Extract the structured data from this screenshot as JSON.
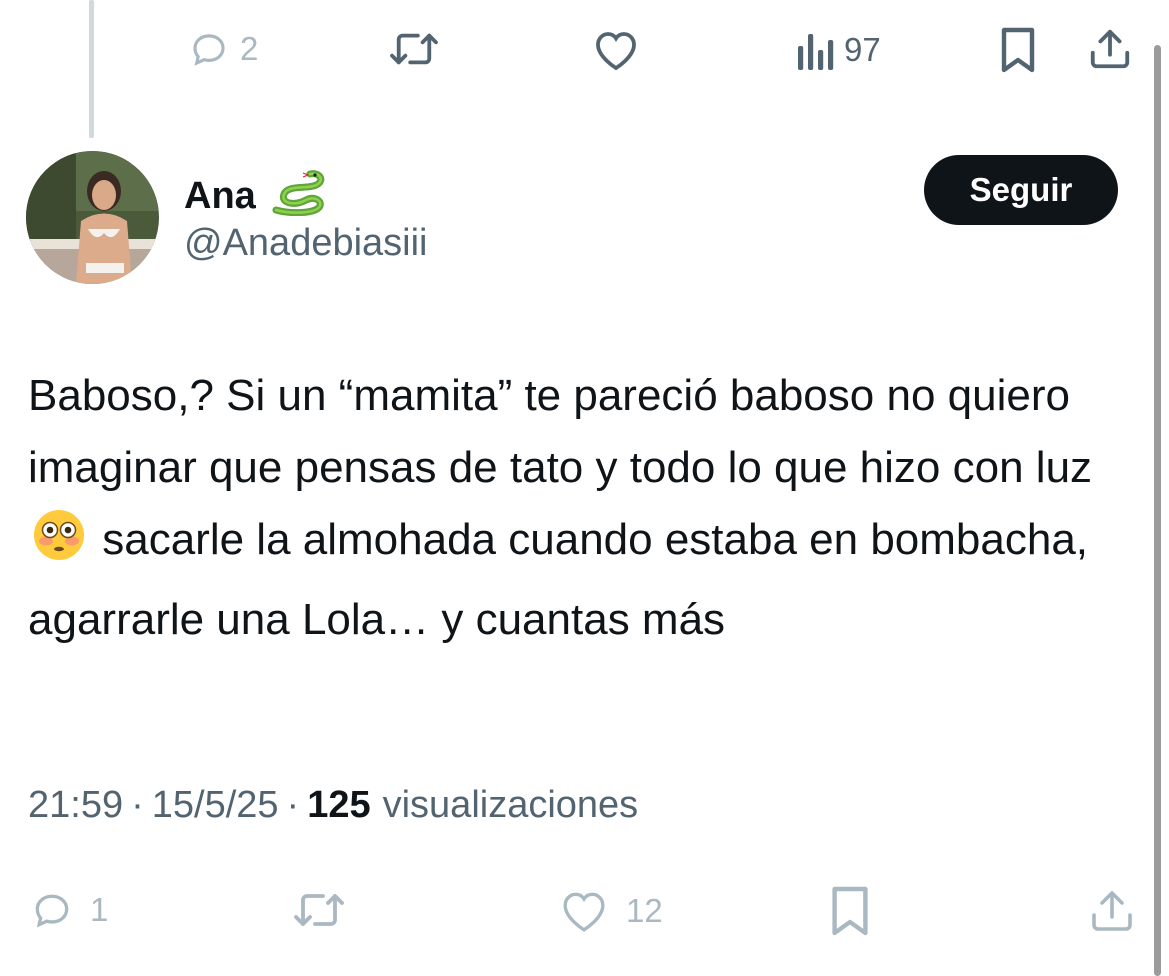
{
  "top_actions": {
    "reply_count": "2",
    "views_count": "97"
  },
  "tweet": {
    "author_name": "Ana",
    "author_emoji": "🐍",
    "handle": "@Anadebiasiii",
    "follow_label": "Seguir",
    "text_part1": "Baboso,? Si un “mamita” te pareció baboso no quiero imaginar que pensas de tato y todo lo que hizo con luz",
    "text_emoji": "😳",
    "text_part2": "sacarle la almohada cuando estaba en bombacha, agarrarle una Lola… y cuantas más",
    "time": "21:59",
    "date": "15/5/25",
    "separator": "·",
    "views": "125",
    "views_label": "visualizaciones"
  },
  "bottom_actions": {
    "reply_count": "1",
    "like_count": "12"
  },
  "icons": {
    "reply": "reply-icon",
    "retweet": "retweet-icon",
    "like": "heart-icon",
    "views": "analytics-icon",
    "bookmark": "bookmark-icon",
    "share": "share-icon"
  },
  "colors": {
    "text": "#0f1419",
    "secondary": "#536471",
    "muted": "#aab8c2",
    "button_bg": "#0f1419",
    "thread_line": "#cfd9de"
  }
}
